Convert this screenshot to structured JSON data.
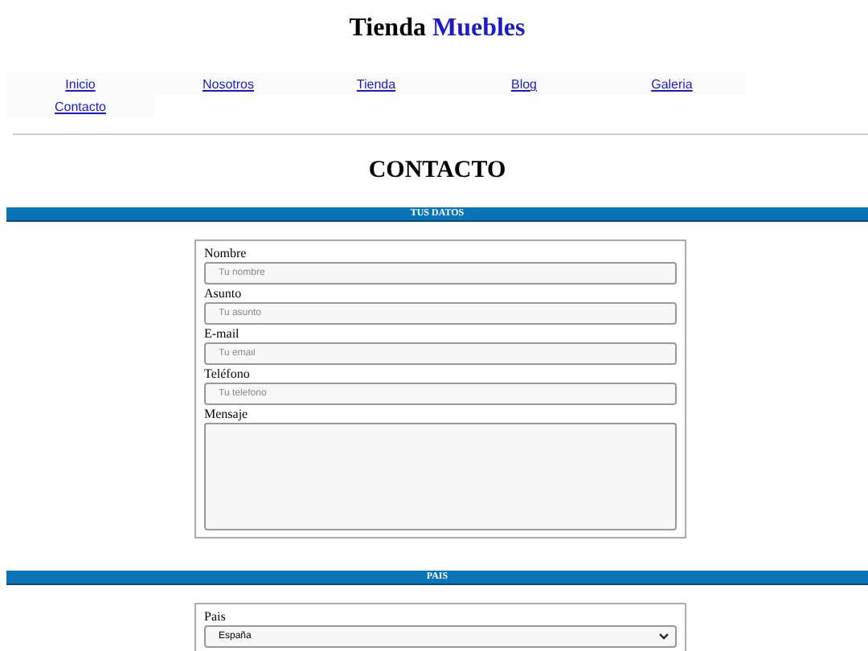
{
  "site_title": {
    "text": "Tienda",
    "highlight": "Muebles"
  },
  "nav": [
    {
      "label": "Inicio"
    },
    {
      "label": "Nosotros"
    },
    {
      "label": "Tienda"
    },
    {
      "label": "Blog"
    },
    {
      "label": "Galeria"
    },
    {
      "label": "Contacto"
    }
  ],
  "heading": "CONTACTO",
  "sections": [
    {
      "title": "TUS DATOS",
      "fields": [
        {
          "kind": "input",
          "label": "Nombre",
          "placeholder": "Tu nombre"
        },
        {
          "kind": "input",
          "label": "Asunto",
          "placeholder": "Tu asunto"
        },
        {
          "kind": "input",
          "label": "E-mail",
          "placeholder": "Tu email"
        },
        {
          "kind": "input",
          "label": "Teléfono",
          "placeholder": "Tu telefono"
        },
        {
          "kind": "textarea",
          "label": "Mensaje"
        }
      ]
    },
    {
      "title": "PAIS",
      "fields": [
        {
          "kind": "select",
          "label": "Pais",
          "value": "España"
        }
      ]
    }
  ]
}
